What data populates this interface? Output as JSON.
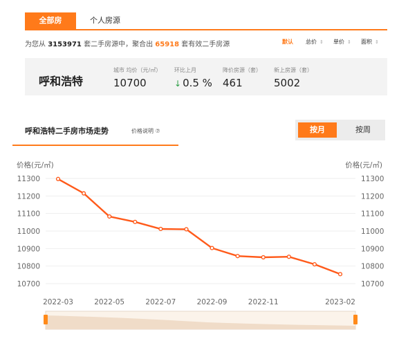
{
  "tabs": {
    "all": "全部房源",
    "personal": "个人房源"
  },
  "summary": {
    "prefix": "为您从",
    "total": "3153971",
    "middle": "套二手房源中，聚合出",
    "valid": "65918",
    "suffix": "套有效二手房源"
  },
  "sort": {
    "default": "默认",
    "total_price": "总价",
    "unit_price": "单价",
    "area": "面积",
    "arrow": "⇕"
  },
  "stats": {
    "city": "呼和浩特",
    "avg_label": "城市 均价（元/㎡）",
    "avg_value": "10700",
    "mom_label": "环比上月",
    "mom_value": "0.5 %",
    "drop_label": "降价房源（套）",
    "drop_value": "461",
    "new_label": "新上房源（套）",
    "new_value": "5002"
  },
  "trend": {
    "title": "呼和浩特二手房市场走势",
    "note": "价格说明 ⑦",
    "by_month": "按月",
    "by_week": "按周"
  },
  "colors": {
    "accent": "#ff7a1a",
    "line": "#ff5a1a",
    "down": "#2a9d44"
  },
  "chart_data": {
    "type": "line",
    "ylabel": "价格(元/㎡)",
    "ylim": [
      10700,
      11300
    ],
    "yticks": [
      10700,
      10800,
      10900,
      11000,
      11100,
      11200,
      11300
    ],
    "x": [
      "2022-03",
      "2022-04",
      "2022-05",
      "2022-06",
      "2022-07",
      "2022-08",
      "2022-09",
      "2022-10",
      "2022-11",
      "2022-12",
      "2023-01",
      "2023-02"
    ],
    "xtick_labels": [
      "2022-03",
      "2022-05",
      "2022-07",
      "2022-09",
      "2022-11",
      "2023-02"
    ],
    "series": [
      {
        "values": [
          11297,
          11215,
          11083,
          11052,
          11012,
          11010,
          10903,
          10857,
          10850,
          10853,
          10810,
          10754
        ]
      }
    ],
    "grid": true,
    "range_slider": true
  }
}
